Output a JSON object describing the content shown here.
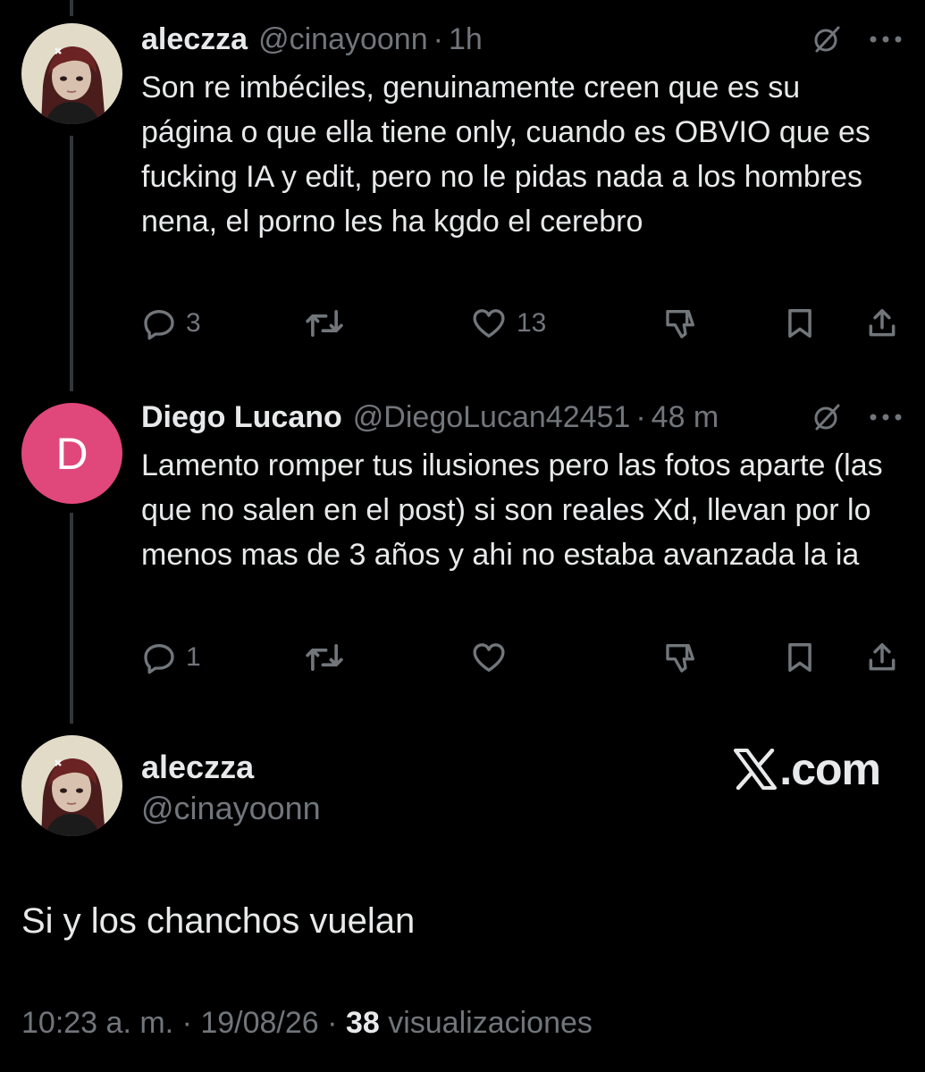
{
  "colors": {
    "background": "#000000",
    "text_primary": "#e7e9ea",
    "text_secondary": "#71767b",
    "thread_line": "#333639",
    "avatar_diego": "#e0477a"
  },
  "replies": [
    {
      "display_name": "aleczza",
      "handle": "@cinayoonn",
      "separator": "·",
      "time": "1h",
      "text": "Son re imbéciles, genuinamente creen que es su página o que ella tiene only, cuando es OBVIO que es fucking IA y edit, pero no le pidas nada a los hombres nena, el porno les ha kgdo el cerebro",
      "reply_count": "3",
      "like_count": "13",
      "icons": [
        "grok-icon",
        "more-icon",
        "reply-icon",
        "retweet-icon",
        "like-icon",
        "dislike-icon",
        "bookmark-icon",
        "share-icon"
      ]
    },
    {
      "display_name": "Diego Lucano",
      "handle": "@DiegoLucan42451",
      "separator": "·",
      "time": "48 m",
      "avatar_letter": "D",
      "text": "Lamento romper tus ilusiones pero las fotos aparte (las que no salen en el post) si son reales Xd, llevan por lo menos mas de 3 años y ahi no estaba avanzada la ia",
      "reply_count": "1",
      "icons": [
        "grok-icon",
        "more-icon",
        "reply-icon",
        "retweet-icon",
        "like-icon",
        "dislike-icon",
        "bookmark-icon",
        "share-icon"
      ]
    }
  ],
  "main_tweet": {
    "display_name": "aleczza",
    "handle": "@cinayoonn",
    "brand": ".com",
    "text": "Si y los chanchos vuelan",
    "time": "10:23 a. m.",
    "separator": "·",
    "date": "19/08/26",
    "views_count": "38",
    "views_label": "visualizaciones"
  }
}
